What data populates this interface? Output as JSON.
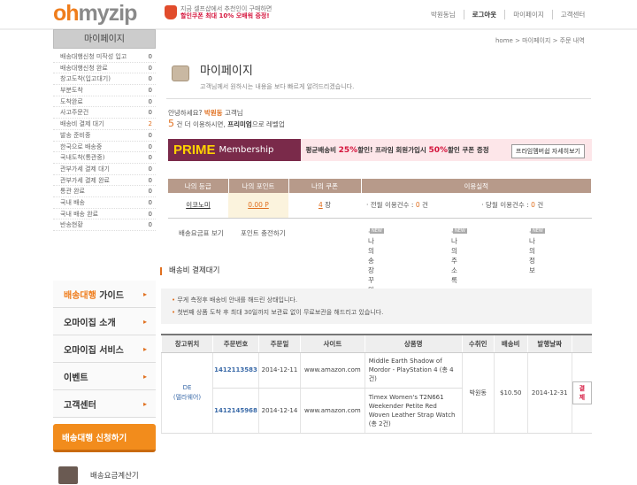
{
  "header": {
    "logo_oh": "oh",
    "logo_myzip": "myzip",
    "promo_line1": "지금 셀프샵에서 추천인이 구매하면",
    "promo_line2": "할인쿠폰 최대 10% 오배워 증정!",
    "nav": [
      "박원동님",
      "로그아웃",
      "마이페이지",
      "고객센터"
    ]
  },
  "sidebar": {
    "title": "마이페이지",
    "items": [
      {
        "label": "배송대행신청 미작성 입고",
        "count": "0"
      },
      {
        "label": "배송대행신청 완료",
        "count": "0"
      },
      {
        "label": "창고도착(입고대기)",
        "count": "0"
      },
      {
        "label": "부분도착",
        "count": "0"
      },
      {
        "label": "도착완료",
        "count": "0"
      },
      {
        "label": "사고주문건",
        "count": "0"
      },
      {
        "label": "배송비 결제 대기",
        "count": "2"
      },
      {
        "label": "발송 준비중",
        "count": "0"
      },
      {
        "label": "한국으로 배송중",
        "count": "0"
      },
      {
        "label": "국내도착(통관중)",
        "count": "0"
      },
      {
        "label": "관부가세 결제 대기",
        "count": "0"
      },
      {
        "label": "관부가세 결제 완료",
        "count": "0"
      },
      {
        "label": "통관 완료",
        "count": "0"
      },
      {
        "label": "국내 배송",
        "count": "0"
      },
      {
        "label": "국내 배송 완료",
        "count": "0"
      },
      {
        "label": "반송현황",
        "count": "0"
      }
    ],
    "menu": [
      {
        "label_or": "배송대행",
        "label": " 가이드"
      },
      {
        "label_or": "",
        "label": "오마이집 소개"
      },
      {
        "label_or": "",
        "label": "오마이집 서비스"
      },
      {
        "label_or": "",
        "label": "이벤트"
      },
      {
        "label_or": "",
        "label": "고객센터"
      }
    ],
    "apply": "배송대행 신청하기",
    "calc": "배송요금계산기"
  },
  "main": {
    "breadcrumb": "home > 마이페이지 > 주문 내역",
    "title": "마이페이지",
    "subtitle": "고객님께서 원하시는 내용을 보다 빠르게 알려드리겠습니다.",
    "greet_pre": "안녕하세요? ",
    "greet_name": "박원동",
    "greet_post": " 고객님",
    "grade_n": "5",
    "grade_text": " 건 더 이용하시면, ",
    "grade_pm": "프리미엄",
    "grade_post": "으로 레벨업",
    "prime": {
      "word": "PRIME",
      "membership": "Membership",
      "text_a": "평균배송비 ",
      "pct1": "25%",
      "text_b": "할인! 프라임 회원가입시 ",
      "pct2": "50%",
      "text_c": "할인 쿠폰 증정",
      "button": "프라임멤버쉽 자세히보기"
    },
    "stats": {
      "headers": [
        "나의 등급",
        "나의 포인트",
        "나의 쿠폰",
        "이용실적"
      ],
      "grade": "이코노미",
      "points": "0.00 P",
      "coupon_n": "4",
      "coupon_unit": " 장",
      "usage1_pre": "· 전월 이용건수 : ",
      "usage1_n": "0",
      "usage1_unit": " 건",
      "usage2_pre": "· 당월 이용건수 : ",
      "usage2_n": "0",
      "usage2_unit": " 건"
    },
    "links": [
      "배송요금표 보기",
      "포인트 충전하기",
      "· 나의송장꾸미기",
      "· 나의 주소록",
      "· 나의 정보"
    ],
    "new_badge": "NEW",
    "section_title": "배송비 결제대기",
    "notice1": "무게 측정후 배송비 안내를 해드린 상태입니다.",
    "notice2": "첫번째 상품 도착 후 최대 30일까지 보관료 없이 무료보관을 해드리고 있습니다.",
    "table": {
      "headers": [
        "창고위치",
        "주문번호",
        "주문일",
        "사이트",
        "상품명",
        "수취인",
        "배송비",
        "발행날짜",
        ""
      ],
      "warehouse": "DE",
      "warehouse_sub": "(델라웨어)",
      "recipient": "박원동",
      "fee": "$10.50",
      "issued": "2014-12-31",
      "pay": "결제",
      "rows": [
        {
          "order": "1412113583",
          "date": "2014-12-11",
          "site": "www.amazon.com",
          "product": "Middle Earth Shadow of Mordor - PlayStation 4 (총 4건)"
        },
        {
          "order": "1412145968",
          "date": "2014-12-14",
          "site": "www.amazon.com",
          "product": "Timex Women's T2N661 Weekender Petite Red Woven Leather Strap Watch (총 2건)"
        }
      ]
    }
  }
}
